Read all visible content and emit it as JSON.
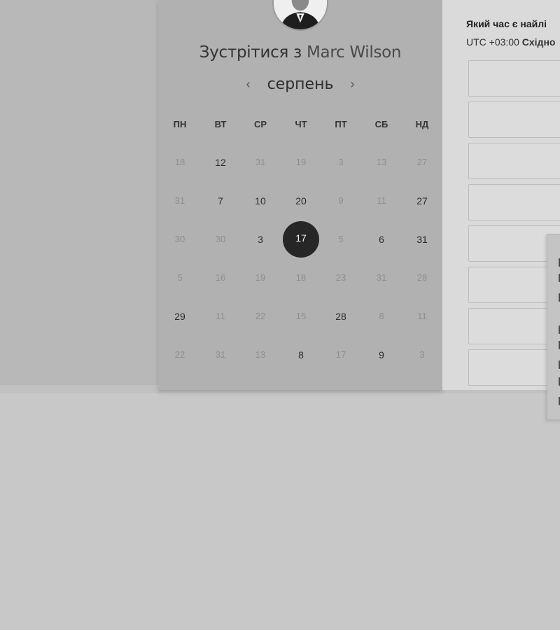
{
  "calendar": {
    "title_prefix": "Зустрітися з",
    "title_name": "Marc Wilson",
    "month": "серпень",
    "prev_arrow": "‹",
    "next_arrow": "›",
    "weekdays": [
      "ПН",
      "ВТ",
      "СР",
      "ЧТ",
      "ПТ",
      "СБ",
      "НД"
    ],
    "selected_day": "17",
    "weeks": [
      [
        {
          "d": "18",
          "m": true
        },
        {
          "d": "12",
          "m": false
        },
        {
          "d": "31",
          "m": true
        },
        {
          "d": "19",
          "m": true
        },
        {
          "d": "3",
          "m": true
        },
        {
          "d": "13",
          "m": true
        },
        {
          "d": "27",
          "m": true
        }
      ],
      [
        {
          "d": "31",
          "m": true
        },
        {
          "d": "7",
          "m": false
        },
        {
          "d": "10",
          "m": false
        },
        {
          "d": "20",
          "m": false
        },
        {
          "d": "9",
          "m": true
        },
        {
          "d": "11",
          "m": true
        },
        {
          "d": "27",
          "m": false
        }
      ],
      [
        {
          "d": "30",
          "m": true
        },
        {
          "d": "30",
          "m": true
        },
        {
          "d": "3",
          "m": false
        },
        {
          "d": "17",
          "m": false,
          "s": true
        },
        {
          "d": "5",
          "m": true
        },
        {
          "d": "6",
          "m": false
        },
        {
          "d": "31",
          "m": false
        }
      ],
      [
        {
          "d": "5",
          "m": true
        },
        {
          "d": "16",
          "m": true
        },
        {
          "d": "19",
          "m": true
        },
        {
          "d": "18",
          "m": true
        },
        {
          "d": "23",
          "m": true
        },
        {
          "d": "31",
          "m": true
        },
        {
          "d": "28",
          "m": true
        }
      ],
      [
        {
          "d": "29",
          "m": false
        },
        {
          "d": "11",
          "m": true
        },
        {
          "d": "22",
          "m": true
        },
        {
          "d": "15",
          "m": true
        },
        {
          "d": "28",
          "m": false
        },
        {
          "d": "8",
          "m": true
        },
        {
          "d": "11",
          "m": true
        }
      ],
      [
        {
          "d": "22",
          "m": true
        },
        {
          "d": "31",
          "m": true
        },
        {
          "d": "13",
          "m": true
        },
        {
          "d": "8",
          "m": false
        },
        {
          "d": "17",
          "m": true
        },
        {
          "d": "9",
          "m": false
        },
        {
          "d": "3",
          "m": true
        }
      ]
    ]
  },
  "time_panel": {
    "heading": "Який час є найлі",
    "tz_offset": "UTC +03:00",
    "tz_name": "Східно",
    "slot_count": 8
  },
  "colors": {
    "selected_day_bg": "#262626",
    "calendar_bg": "#b1b1b1",
    "page_bg": "#c8c8c8"
  }
}
